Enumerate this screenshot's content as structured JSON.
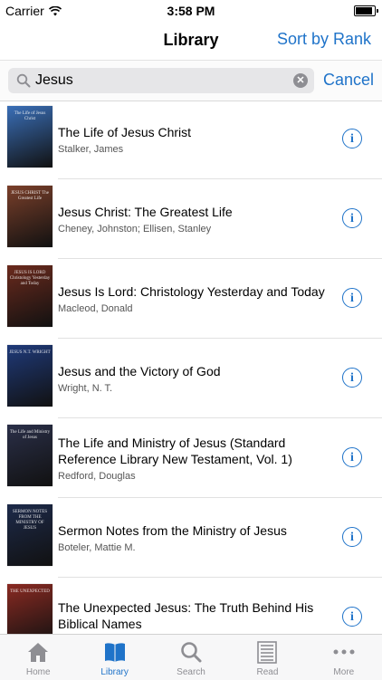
{
  "status_bar": {
    "carrier": "Carrier",
    "time": "3:58 PM"
  },
  "nav": {
    "title": "Library",
    "sort_label": "Sort by Rank"
  },
  "search": {
    "value": "Jesus",
    "cancel_label": "Cancel"
  },
  "books": [
    {
      "title": "The Life of Jesus Christ",
      "author": "Stalker, James",
      "cover_color": "#3a6fb8",
      "cover_text": "The Life of Jesus Christ"
    },
    {
      "title": "Jesus Christ: The Greatest Life",
      "author": "Cheney, Johnston; Ellisen, Stanley",
      "cover_color": "#7a3f2a",
      "cover_text": "JESUS CHRIST The Greatest Life"
    },
    {
      "title": "Jesus Is Lord: Christology Yesterday and Today",
      "author": "Macleod, Donald",
      "cover_color": "#6b2a1d",
      "cover_text": "JESUS IS LORD Christology Yesterday and Today"
    },
    {
      "title": "Jesus and the Victory of God",
      "author": "Wright, N. T.",
      "cover_color": "#1f3a7a",
      "cover_text": "JESUS N.T. WRIGHT"
    },
    {
      "title": "The Life and Ministry of Jesus (Standard Reference Library New Testament, Vol. 1)",
      "author": "Redford, Douglas",
      "cover_color": "#2a2f48",
      "cover_text": "The Life and Ministry of Jesus"
    },
    {
      "title": "Sermon Notes from the Ministry of Jesus",
      "author": "Boteler, Mattie M.",
      "cover_color": "#1d2a4a",
      "cover_text": "SERMON NOTES FROM THE MINISTRY OF JESUS"
    },
    {
      "title": "The Unexpected Jesus: The Truth Behind His Biblical Names",
      "author": "",
      "cover_color": "#8a2a22",
      "cover_text": "THE UNEXPECTED"
    }
  ],
  "tabs": [
    {
      "label": "Home",
      "icon": "home-icon",
      "active": false
    },
    {
      "label": "Library",
      "icon": "book-icon",
      "active": true
    },
    {
      "label": "Search",
      "icon": "search-icon",
      "active": false
    },
    {
      "label": "Read",
      "icon": "reader-icon",
      "active": false
    },
    {
      "label": "More",
      "icon": "more-icon",
      "active": false
    }
  ],
  "colors": {
    "accent": "#1f73c9",
    "inactive": "#8e8e93"
  }
}
